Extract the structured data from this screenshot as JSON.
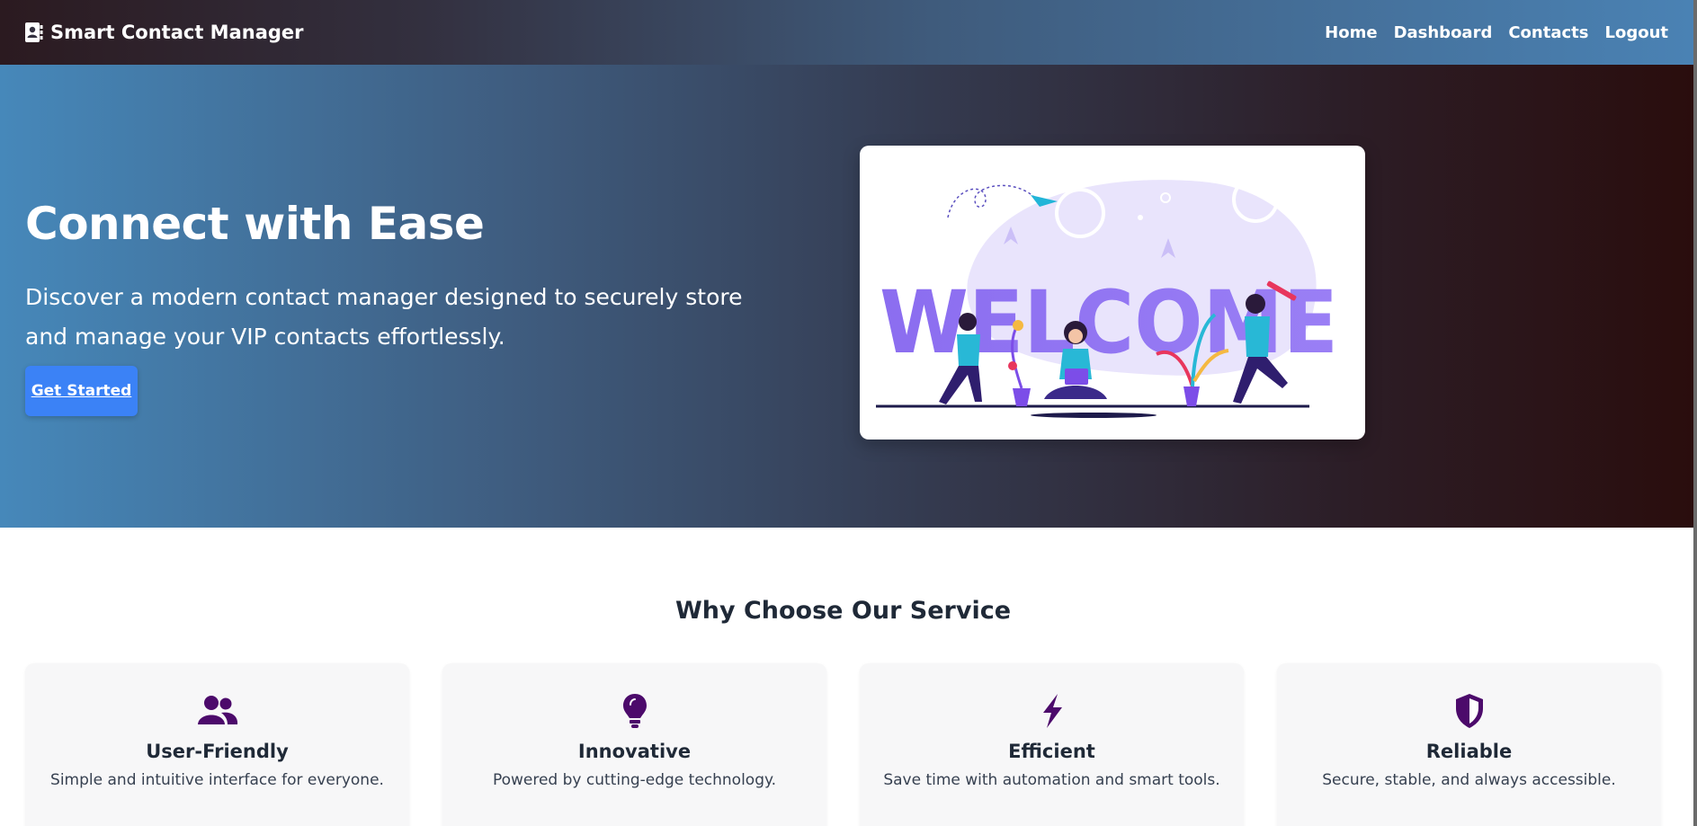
{
  "brand": {
    "name": "Smart Contact Manager",
    "icon": "contact-book-icon"
  },
  "nav": {
    "items": [
      "Home",
      "Dashboard",
      "Contacts",
      "Logout"
    ]
  },
  "hero": {
    "title": "Connect with Ease",
    "subtitle": "Discover a modern contact manager designed to securely store and manage your VIP contacts effortlessly.",
    "cta_label": "Get Started",
    "illustration_text": "WELCOME"
  },
  "features": {
    "title": "Why Choose Our Service",
    "items": [
      {
        "icon": "users-icon",
        "title": "User-Friendly",
        "description": "Simple and intuitive interface for everyone."
      },
      {
        "icon": "lightbulb-icon",
        "title": "Innovative",
        "description": "Powered by cutting-edge technology."
      },
      {
        "icon": "lightning-icon",
        "title": "Efficient",
        "description": "Save time with automation and smart tools."
      },
      {
        "icon": "shield-icon",
        "title": "Reliable",
        "description": "Secure, stable, and always accessible."
      }
    ]
  },
  "colors": {
    "accent": "#3b82f6",
    "icon": "#4c0a6b",
    "hero_gradient_start": "#4688ba",
    "hero_gradient_end": "#2a0d0d"
  }
}
